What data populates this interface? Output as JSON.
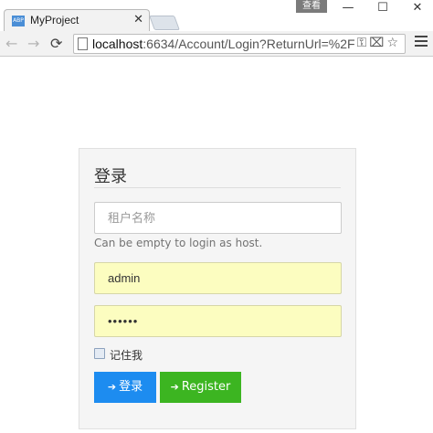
{
  "browser": {
    "tab_title": "MyProject",
    "tab_favicon_text": "ABP",
    "tab_close_glyph": "✕",
    "user_badge": "查看",
    "window_buttons": {
      "minimize": "—",
      "maximize": "☐",
      "close": "✕"
    },
    "nav": {
      "back": "←",
      "forward": "→",
      "reload": "⟳"
    },
    "url_host": "localhost",
    "url_rest": ":6634/Account/Login?ReturnUrl=%2F",
    "omnibox_icons": "⚿⌧☆",
    "icons": [
      "page-icon",
      "key-icon",
      "translate-icon",
      "star-icon",
      "menu-icon"
    ]
  },
  "login": {
    "title": "登录",
    "tenant_placeholder": "租户名称",
    "tenant_help": "Can be empty to login as host.",
    "username_value": "admin",
    "password_value": "••••••",
    "remember_label": "记住我",
    "remember_checked": false,
    "login_button": "登录",
    "login_icon": "➔",
    "register_button": "Register",
    "register_icon": "➔",
    "colors": {
      "login_button": "#1d8cf0",
      "register_button": "#3cb521",
      "autofill": "#fcfdc0"
    }
  }
}
